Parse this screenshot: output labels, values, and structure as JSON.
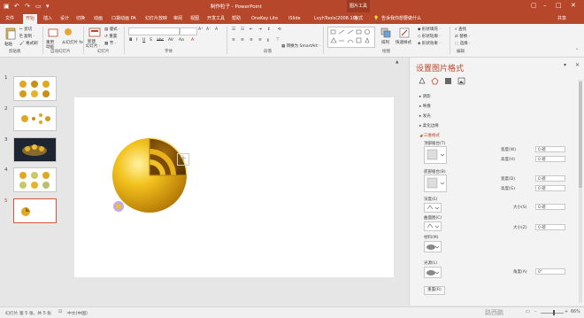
{
  "titlebar": {
    "title": "制作粒子 - PowerPoint",
    "tools_label": "图片工具",
    "colors": {
      "brand": "#b7472a",
      "accent_dark": "#9e3a21"
    }
  },
  "tabs": [
    {
      "label": "文件"
    },
    {
      "label": "开始"
    },
    {
      "label": "插入"
    },
    {
      "label": "设计"
    },
    {
      "label": "切换"
    },
    {
      "label": "动画"
    },
    {
      "label": "口袋动画 PA"
    },
    {
      "label": "幻灯片放映"
    },
    {
      "label": "审阅"
    },
    {
      "label": "视图"
    },
    {
      "label": "开发工具"
    },
    {
      "label": "帮助"
    },
    {
      "label": "OneKey Lite"
    },
    {
      "label": "iSlide"
    },
    {
      "label": "LvyhTools(2008.10)"
    },
    {
      "label": "格式"
    },
    {
      "label": "告诉我你想要做什么"
    },
    {
      "label": "共享"
    }
  ],
  "ribbon": {
    "paste": "粘贴",
    "cut": "剪切",
    "copy": "复制 ·",
    "format_painter": "格式刷",
    "pick_from_pptx": "从幻灯片 fe",
    "reuse": "重用",
    "animation": "动画",
    "new_slide": "新建",
    "new_slide_2": "幻灯片 ·",
    "layout": "版式 ·",
    "reset": "重置",
    "section": "节 ·",
    "convert_smartart": "转换为 SmartArt ·",
    "arrange": "排列",
    "quick_styles": "快速样式",
    "shape_fill": "形状填充 ·",
    "shape_outline": "形状轮廓 ·",
    "shape_effects": "形状效果 ·",
    "find": "查找",
    "replace": "替换 ·",
    "select": "选择 ·",
    "groups": {
      "clipboard": "剪贴板",
      "slides_from": "自动幻灯片",
      "slides": "幻灯片",
      "font": "字体",
      "paragraph": "段落",
      "drawing": "绘图",
      "editing": "编辑"
    }
  },
  "slides": [
    {
      "num": "1"
    },
    {
      "num": "2"
    },
    {
      "num": "3"
    },
    {
      "num": "4"
    },
    {
      "num": "5"
    }
  ],
  "canvas": {
    "add_label": "+"
  },
  "pane": {
    "title": "设置图片格式",
    "sections": [
      {
        "label": "▸ 阴影"
      },
      {
        "label": "▸ 映像"
      },
      {
        "label": "▸ 发光"
      },
      {
        "label": "▸ 柔化边缘"
      },
      {
        "label": "◢ 三维格式"
      }
    ],
    "top_bevel": "顶部棱台(T)",
    "bottom_bevel": "底部棱台(B)",
    "width_t": "宽度(W)",
    "height_t": "高度(H)",
    "width_b": "宽度(D)",
    "height_b": "高度(G)",
    "depth": "深度(E)",
    "depth_size": "大小(S)",
    "contour": "曲面图(C)",
    "contour_size": "大小(Z)",
    "material": "材料(M)",
    "lighting": "光源(L)",
    "angle": "角度(A)",
    "reset_button": "重置(R)",
    "values": {
      "width_t": "0 磅",
      "height_t": "0 磅",
      "width_b": "0 磅",
      "height_b": "0 磅",
      "depth_size": "0 磅",
      "contour_size": "0 磅",
      "angle": "0°"
    }
  },
  "statusbar": {
    "slide_info": "幻灯片 第 5 张，共 5 张",
    "lang": "中文(中国)",
    "zoom": "66%",
    "watermark": "路西鹏"
  }
}
